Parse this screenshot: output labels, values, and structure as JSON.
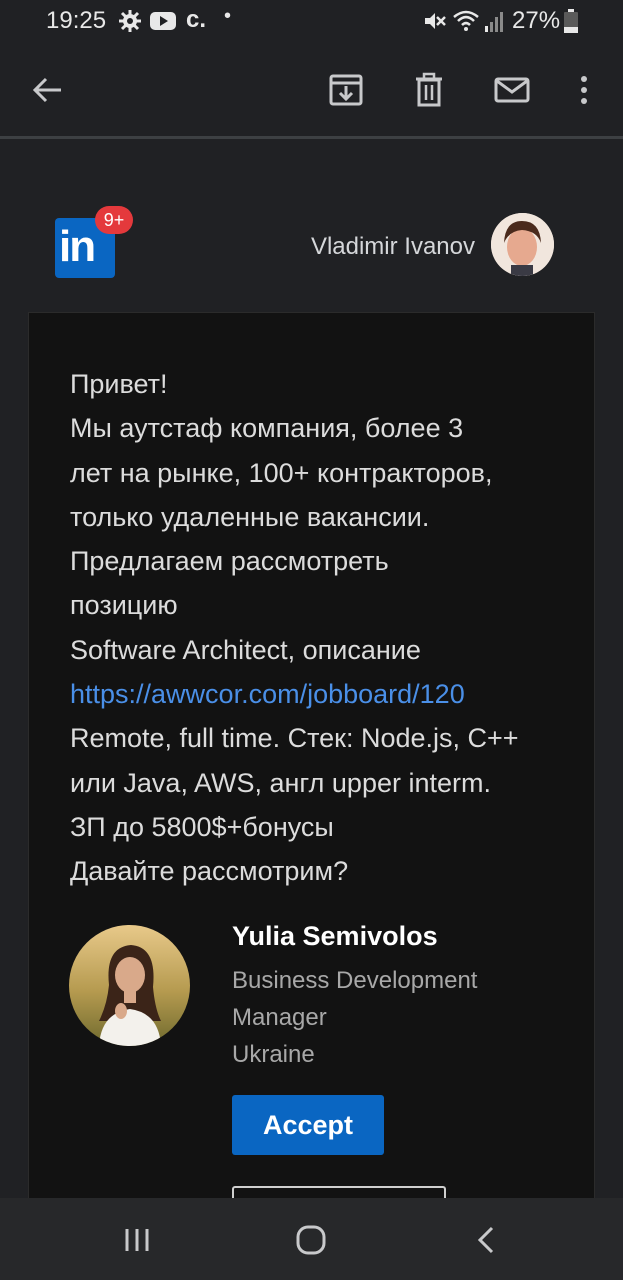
{
  "status_bar": {
    "time": "19:25",
    "carrier_glyph": "c.",
    "dot": "•",
    "battery": "27%",
    "icons": [
      "gear-icon",
      "youtube-icon",
      "mute-icon",
      "wifi-icon",
      "signal-icon",
      "battery-icon"
    ]
  },
  "toolbar": {
    "icons": [
      "back-arrow-icon",
      "archive-icon",
      "trash-icon",
      "mail-icon",
      "more-vert-icon"
    ]
  },
  "email_header": {
    "logo_text": "in",
    "notification_badge": "9+",
    "recipient_name": "Vladimir Ivanov"
  },
  "message": {
    "lines": [
      "Привет!",
      "Мы аутстаф компания, более 3",
      "лет на рынке, 100+ контракторов,",
      "только удаленные вакансии.",
      "Предлагаем рассмотреть",
      "позицию",
      "Software Architect, описание",
      "https://awwcor.com/jobboard/120",
      "Remote, full time. Стек: Node.js, C++",
      "или Java, AWS, англ upper interm.",
      "ЗП до 5800$+бонусы",
      "Давайте рассмотрим?"
    ]
  },
  "sender": {
    "name": "Yulia Semivolos",
    "title": "Business Development Manager",
    "location": "Ukraine",
    "accept_label": "Accept"
  },
  "colors": {
    "background": "#202124",
    "card": "#121212",
    "accent": "#0a66c2",
    "link": "#4a8fe7",
    "badge": "#e4393c"
  },
  "nav_bar": {
    "icons": [
      "recents-icon",
      "home-icon",
      "back-icon"
    ]
  }
}
